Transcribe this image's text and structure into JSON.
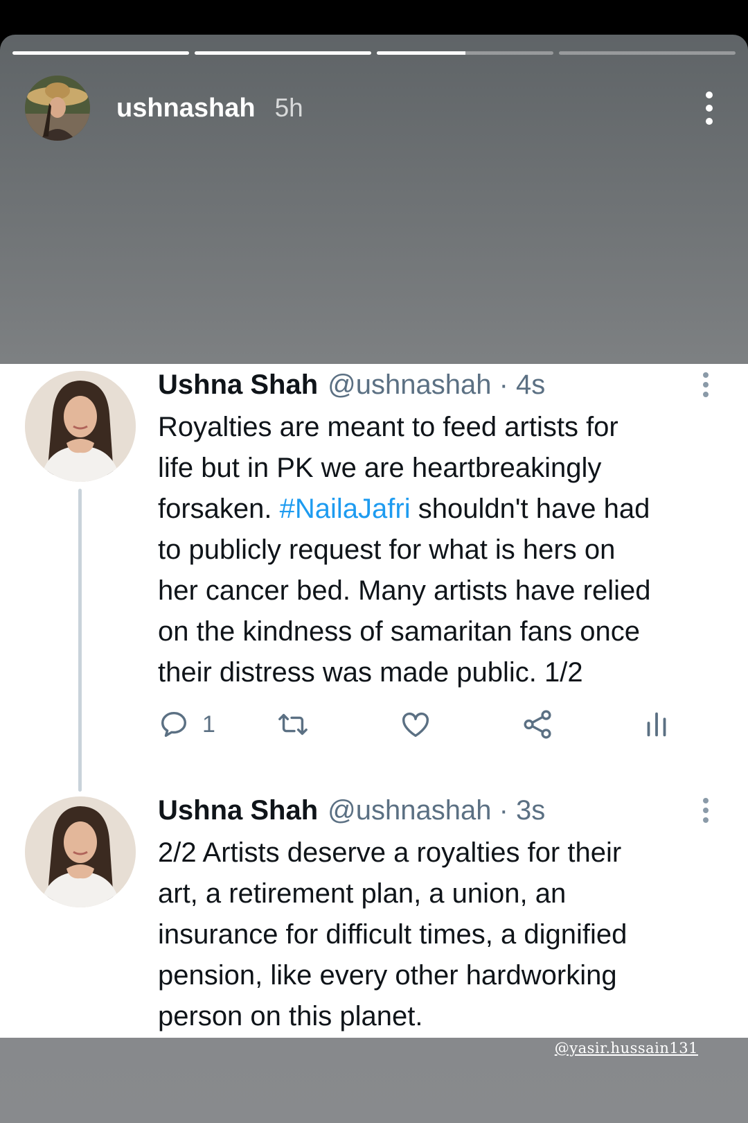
{
  "story": {
    "username": "ushnashah",
    "age": "5h",
    "progress": [
      1,
      1,
      0.5,
      0
    ]
  },
  "tweets": [
    {
      "name": "Ushna Shah",
      "meta": "@ushnashah · 4s",
      "text_before": "Royalties are meant to feed artists for\nlife but in PK we are heartbreakingly\nforsaken. ",
      "hashtag": "#NailaJafri",
      "text_after": " shouldn't have had\nto publicly request for what is hers on\nher cancer bed. Many artists have relied\non the kindness of samaritan fans once\ntheir distress was made public. 1/2",
      "reply_count": "1"
    },
    {
      "name": "Ushna Shah",
      "meta": "@ushnashah · 3s",
      "text": "2/2 Artists deserve a royalties for their\nart, a retirement plan, a union, an\ninsurance for difficult times, a dignified\npension, like every other hardworking\nperson on this planet."
    }
  ],
  "credit": "@yasir.hussain131",
  "icons": {
    "reply": "reply-icon",
    "retweet": "retweet-icon",
    "like": "heart-icon",
    "share": "share-icon",
    "analytics": "analytics-icon"
  },
  "colors": {
    "hashtag": "#1d9bf0",
    "meta": "#5b7083",
    "thread_line": "#c9d3da"
  }
}
